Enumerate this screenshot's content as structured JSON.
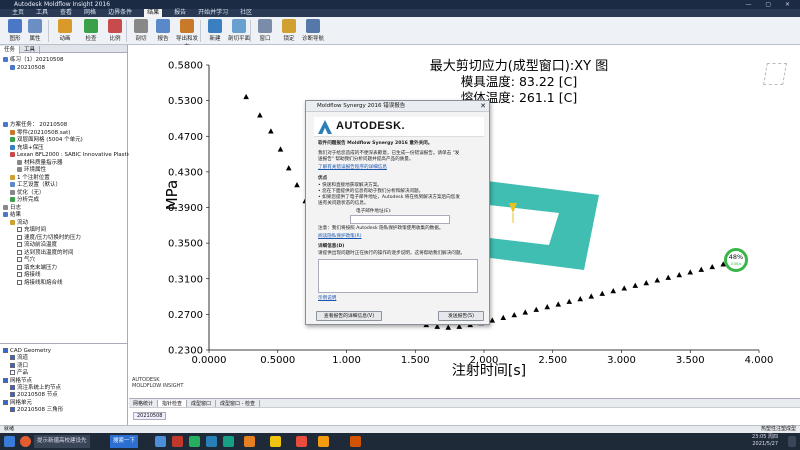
{
  "window": {
    "title": "Autodesk Moldflow Insight 2016",
    "controls": "—  ▢  ✕"
  },
  "menu": [
    "主页",
    "工具",
    "查看",
    "网格",
    "边界条件",
    "结果",
    "报告",
    "开始并学习",
    "社区"
  ],
  "menu_active": "结果",
  "ribbon": [
    {
      "label": "图形",
      "icon": "chart-icon",
      "color": "#4a78c6"
    },
    {
      "label": "属性",
      "icon": "properties-icon",
      "color": "#6b8fc2"
    },
    {
      "label": "动画",
      "icon": "animation-icon",
      "color": "#d99a2b"
    },
    {
      "label": "检查",
      "icon": "check-icon",
      "color": "#3aa04a"
    },
    {
      "label": "比例",
      "icon": "scale-icon",
      "color": "#c84a4a"
    },
    {
      "label": "剖切",
      "icon": "cut-icon",
      "color": "#888888"
    },
    {
      "label": "报告",
      "icon": "report-icon",
      "color": "#5a88c8"
    },
    {
      "label": "导出和发布",
      "icon": "export-icon",
      "color": "#c87a2a"
    },
    {
      "label": "新建",
      "icon": "new-icon",
      "color": "#3a7fc0"
    },
    {
      "label": "剖切平面",
      "icon": "plane-icon",
      "color": "#6aa0d0"
    },
    {
      "label": "窗口",
      "icon": "window-icon",
      "color": "#7a8ca8"
    },
    {
      "label": "锁定",
      "icon": "lock-icon",
      "color": "#d0a030"
    },
    {
      "label": "诊断导航",
      "icon": "diagnostic-icon",
      "color": "#5577aa"
    }
  ],
  "left_panel": {
    "tabs": [
      "任务",
      "工具"
    ],
    "project_rows": [
      "练习（1）20210508",
      "20210508"
    ],
    "tree_rows": [
      {
        "text": "方案任务： 20210508",
        "indent": 0,
        "color": "#4a78c6"
      },
      {
        "text": "零件(20210508.sat)",
        "indent": 1,
        "color": "#c87a2a"
      },
      {
        "text": "双层面网格 (5004 个单元)",
        "indent": 1,
        "color": "#3aa04a"
      },
      {
        "text": "充填+保压",
        "indent": 1,
        "color": "#3a7fc0"
      },
      {
        "text": "Lexan BFL2000 : SABIC Innovative Plastics J",
        "indent": 1,
        "color": "#c84a4a"
      },
      {
        "text": "材料质量指示器",
        "indent": 2,
        "color": "#888888"
      },
      {
        "text": "环境属性",
        "indent": 2,
        "color": "#888888"
      },
      {
        "text": "1 个注射位置",
        "indent": 1,
        "color": "#d0a030"
      },
      {
        "text": "工艺设置（默认）",
        "indent": 1,
        "color": "#5a88c8"
      },
      {
        "text": "优化（无）",
        "indent": 1,
        "color": "#888888"
      },
      {
        "text": "分析完成",
        "indent": 1,
        "color": "#3aa04a"
      },
      {
        "text": "日志",
        "indent": 0,
        "color": "#888888"
      },
      {
        "text": "结果",
        "indent": 0,
        "color": "#4a78c6"
      },
      {
        "text": "流动",
        "indent": 1,
        "color": "#d0a030"
      },
      {
        "text": "充填时间",
        "indent": 2,
        "color": ""
      },
      {
        "text": "速度/压力切换时的压力",
        "indent": 2,
        "color": ""
      },
      {
        "text": "流动前沿温度",
        "indent": 2,
        "color": ""
      },
      {
        "text": "达到顶出温度的时间",
        "indent": 2,
        "color": ""
      },
      {
        "text": "气穴",
        "indent": 2,
        "color": ""
      },
      {
        "text": "填充末端压力",
        "indent": 2,
        "color": ""
      },
      {
        "text": "熔接线",
        "indent": 2,
        "color": ""
      },
      {
        "text": "熔接线和熔合线",
        "indent": 2,
        "color": ""
      }
    ],
    "layers": [
      {
        "text": "CAD Geometry",
        "indent": 0,
        "on": true
      },
      {
        "text": "流道",
        "indent": 1,
        "on": true
      },
      {
        "text": "浇口",
        "indent": 1,
        "on": true
      },
      {
        "text": "产品",
        "indent": 1,
        "on": false
      },
      {
        "text": "网格节点",
        "indent": 0,
        "on": true
      },
      {
        "text": "流注系统上的节点",
        "indent": 1,
        "on": true
      },
      {
        "text": "20210508 节点",
        "indent": 1,
        "on": true
      },
      {
        "text": "网格单元",
        "indent": 0,
        "on": true
      },
      {
        "text": "20210508 三角形",
        "indent": 1,
        "on": true
      }
    ]
  },
  "chart_data": {
    "type": "scatter",
    "title": "最大剪切应力(成型窗口):XY 图",
    "subtitle_lines": [
      "模具温度: 83.22 [C]",
      "熔体温度: 261.1 [C]"
    ],
    "xlabel": "注射时间[s]",
    "ylabel": "MPa",
    "xlim": [
      0.0,
      4.0
    ],
    "ylim": [
      0.23,
      0.58
    ],
    "xticks": [
      "0.0000",
      "0.5000",
      "1.000",
      "1.500",
      "2.000",
      "2.500",
      "3.000",
      "3.500",
      "4.000"
    ],
    "yticks": [
      "0.2300",
      "0.2700",
      "0.3100",
      "0.3500",
      "0.3900",
      "0.4300",
      "0.4700",
      "0.5300",
      "0.5800"
    ],
    "marker": "triangle",
    "x": [
      0.27,
      0.37,
      0.45,
      0.52,
      0.58,
      0.64,
      0.7,
      0.76,
      0.82,
      0.89,
      0.96,
      1.03,
      1.1,
      1.18,
      1.26,
      1.34,
      1.42,
      1.5,
      1.58,
      1.66,
      1.74,
      1.82,
      1.9,
      1.98,
      2.06,
      2.14,
      2.22,
      2.3,
      2.38,
      2.46,
      2.54,
      2.62,
      2.7,
      2.78,
      2.86,
      2.94,
      3.02,
      3.1,
      3.18,
      3.26,
      3.34,
      3.42,
      3.5,
      3.58,
      3.66,
      3.74,
      3.82,
      3.9
    ],
    "y": [
      0.535,
      0.505,
      0.478,
      0.455,
      0.434,
      0.415,
      0.397,
      0.381,
      0.365,
      0.35,
      0.336,
      0.322,
      0.308,
      0.296,
      0.285,
      0.276,
      0.268,
      0.262,
      0.258,
      0.256,
      0.255,
      0.256,
      0.258,
      0.26,
      0.263,
      0.266,
      0.269,
      0.272,
      0.275,
      0.278,
      0.281,
      0.284,
      0.287,
      0.29,
      0.293,
      0.296,
      0.299,
      0.302,
      0.305,
      0.308,
      0.311,
      0.314,
      0.317,
      0.32,
      0.323,
      0.326,
      0.329,
      0.332
    ],
    "grid": false,
    "color": "#000000"
  },
  "plot_footer": [
    "AUTODESK",
    "MOLDFLOW INSIGHT"
  ],
  "gauge": {
    "value": "48%",
    "sub": "0.0K/s"
  },
  "model_color": "#2ab7a8",
  "dialog": {
    "title": "Moldflow Synergy 2016 错误报告",
    "close": "✕",
    "logo": "AUTODESK.",
    "heading": "软件问题报告 Moldflow Synergy 2016 意外关闭。",
    "para1": [
      "我们对于给您造成的不便深表歉意，已生成一份错误报告。请单击 \"发",
      "送报告\" 帮助我们分析问题并提高产品的质量。"
    ],
    "link1": "了解有关错误报告程序的详细信息",
    "section_priority": "优点",
    "bullets": [
      "• 快速和直接地获取解决方案。",
      "• 您在下面提供的信息有助于我们分析和解决问题。",
      "• 如果您提供了电子邮件地址，Autodesk 将在找到解决方案后向您发",
      "  送有关问题状态的信息。"
    ],
    "email_label": "电子邮件地址(E):",
    "privacy": "注意：我们将按照 Autodesk 隐私保护政策使用收集的数据。",
    "privacy_link": "阅读隐私保护政策(R)",
    "section_details": "详细信息(D)",
    "details_hint": "请提供出现问题时正在执行的操作的逐步说明，这将帮助我们解决问题。",
    "example_link": "示例说明",
    "btn_view": "查看报告的详细信息(V)",
    "btn_send": "发送报告(S)"
  },
  "bottom_tabs": [
    "网格统计",
    "指针检查",
    "成型窗口",
    "成型窗口 - 检查"
  ],
  "bottom_tabs_selected": "指针检查",
  "study_tab": "20210508",
  "status": {
    "left": "就绪",
    "right": "热塑性注塑成型"
  },
  "taskbar": {
    "app1": "提示新疆高校建设先",
    "app2": "搜索一下",
    "time": "23:05 周四",
    "date": "2021/5/27"
  }
}
